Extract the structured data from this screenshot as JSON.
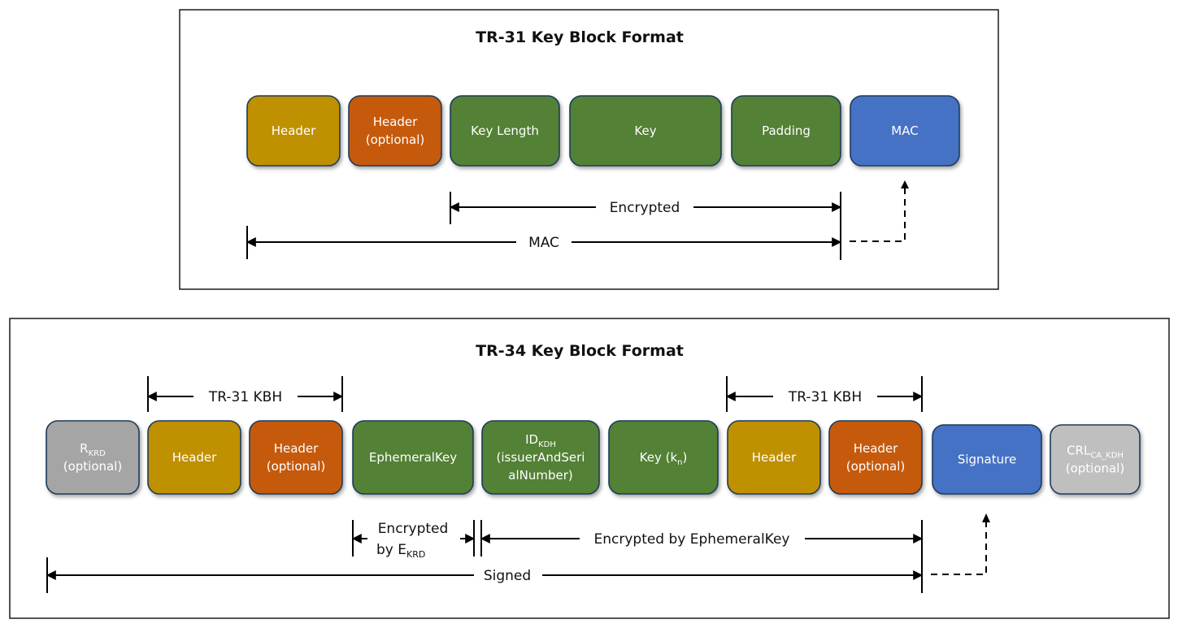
{
  "tr31": {
    "title": "TR-31 Key Block Format",
    "blocks": [
      {
        "id": "header",
        "lines": [
          "Header"
        ],
        "color": "#bf9000"
      },
      {
        "id": "header-optional",
        "lines": [
          "Header",
          "(optional)"
        ],
        "color": "#c55a11"
      },
      {
        "id": "key-length",
        "lines": [
          "Key Length"
        ],
        "color": "#538135"
      },
      {
        "id": "key",
        "lines": [
          "Key"
        ],
        "color": "#538135"
      },
      {
        "id": "padding",
        "lines": [
          "Padding"
        ],
        "color": "#538135"
      },
      {
        "id": "mac",
        "lines": [
          "MAC"
        ],
        "color": "#4472c4"
      }
    ],
    "spans": {
      "encrypted": "Encrypted",
      "mac": "MAC"
    }
  },
  "tr34": {
    "title": "TR-34 Key Block Format",
    "blocks": [
      {
        "id": "r-krd",
        "main": "R",
        "sub": "KRD",
        "line2": "(optional)",
        "color": "#a5a5a5"
      },
      {
        "id": "header-1",
        "lines": [
          "Header"
        ],
        "color": "#bf9000"
      },
      {
        "id": "header-optional-1",
        "lines": [
          "Header",
          "(optional)"
        ],
        "color": "#c55a11"
      },
      {
        "id": "ephemeral-key",
        "lines": [
          "EphemeralKey"
        ],
        "color": "#538135"
      },
      {
        "id": "id-kdh",
        "main": "ID",
        "sub": "KDH",
        "line2": "(issuerAndSeri",
        "line3": "alNumber)",
        "color": "#538135"
      },
      {
        "id": "key-kn",
        "main": "Key (k",
        "sub": "n",
        "suffix": ")",
        "color": "#538135"
      },
      {
        "id": "header-2",
        "lines": [
          "Header"
        ],
        "color": "#bf9000"
      },
      {
        "id": "header-optional-2",
        "lines": [
          "Header",
          "(optional)"
        ],
        "color": "#c55a11"
      },
      {
        "id": "signature",
        "lines": [
          "Signature"
        ],
        "color": "#4472c4"
      },
      {
        "id": "crl-ca-kdh",
        "main": "CRL",
        "sub": "CA_KDH",
        "line2": "(optional)",
        "color": "#bfbfbf"
      }
    ],
    "spans": {
      "kbh_left": "TR-31 KBH",
      "kbh_right": "TR-31 KBH",
      "encrypted_by_ekrd_line1": "Encrypted",
      "encrypted_by_ekrd_line2": "by E",
      "encrypted_by_ekrd_sub": "KRD",
      "encrypted_by_ephemeral": "Encrypted by EphemeralKey",
      "signed": "Signed"
    }
  }
}
